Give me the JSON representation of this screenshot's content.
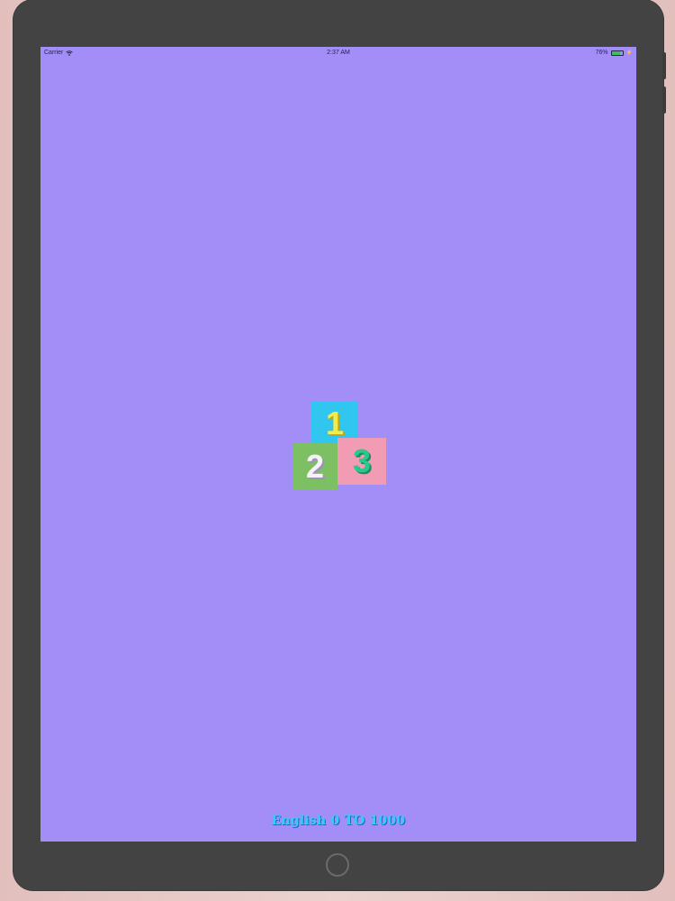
{
  "status_bar": {
    "carrier": "Carrier",
    "time": "2:37 AM",
    "battery": "76%",
    "battery_level": 0.76
  },
  "app_logo": {
    "block_one": "1",
    "block_two": "2",
    "block_three": "3"
  },
  "footer": {
    "title": "English 0 TO 1000"
  },
  "colors": {
    "screen_bg": "#a28ef6",
    "device_frame": "#434343",
    "block_one_bg": "#30c6f0",
    "block_two_bg": "#7dbf63",
    "block_three_bg": "#f19cb4",
    "title_color": "#2fd0f0"
  },
  "icons": {
    "wifi": "wifi-icon",
    "battery": "battery-icon",
    "charging": "charging-icon",
    "home": "home-button-icon"
  }
}
